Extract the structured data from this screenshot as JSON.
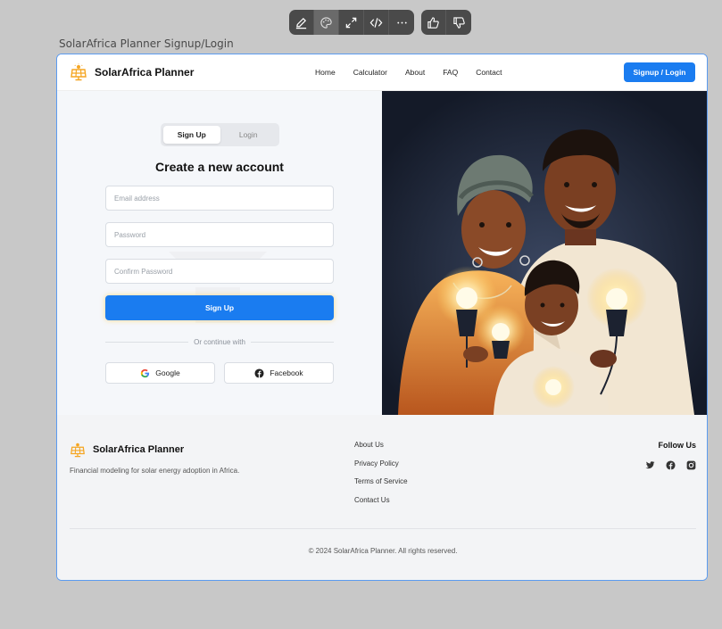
{
  "frame_title": "SolarAfrica Planner Signup/Login",
  "brand": {
    "name": "SolarAfrica Planner",
    "accent": "#f5a623"
  },
  "nav": {
    "links": [
      "Home",
      "Calculator",
      "About",
      "FAQ",
      "Contact"
    ],
    "cta": "Signup / Login"
  },
  "auth": {
    "tabs": [
      "Sign Up",
      "Login"
    ],
    "active_tab": "Sign Up",
    "title": "Create a new account",
    "email_placeholder": "Email address",
    "password_placeholder": "Password",
    "confirm_placeholder": "Confirm Password",
    "submit_label": "Sign Up",
    "divider_text": "Or continue with",
    "google_label": "Google",
    "facebook_label": "Facebook"
  },
  "footer": {
    "brand_name": "SolarAfrica Planner",
    "tagline": "Financial modeling for solar energy adoption in Africa.",
    "links": [
      "About Us",
      "Privacy Policy",
      "Terms of Service",
      "Contact Us"
    ],
    "follow_heading": "Follow Us",
    "social_icons": [
      "twitter-icon",
      "facebook-icon",
      "instagram-icon"
    ],
    "copyright": "© 2024 SolarAfrica Planner. All rights reserved."
  },
  "colors": {
    "primary": "#1a7cf0",
    "frame_border": "#5b9bf0"
  }
}
